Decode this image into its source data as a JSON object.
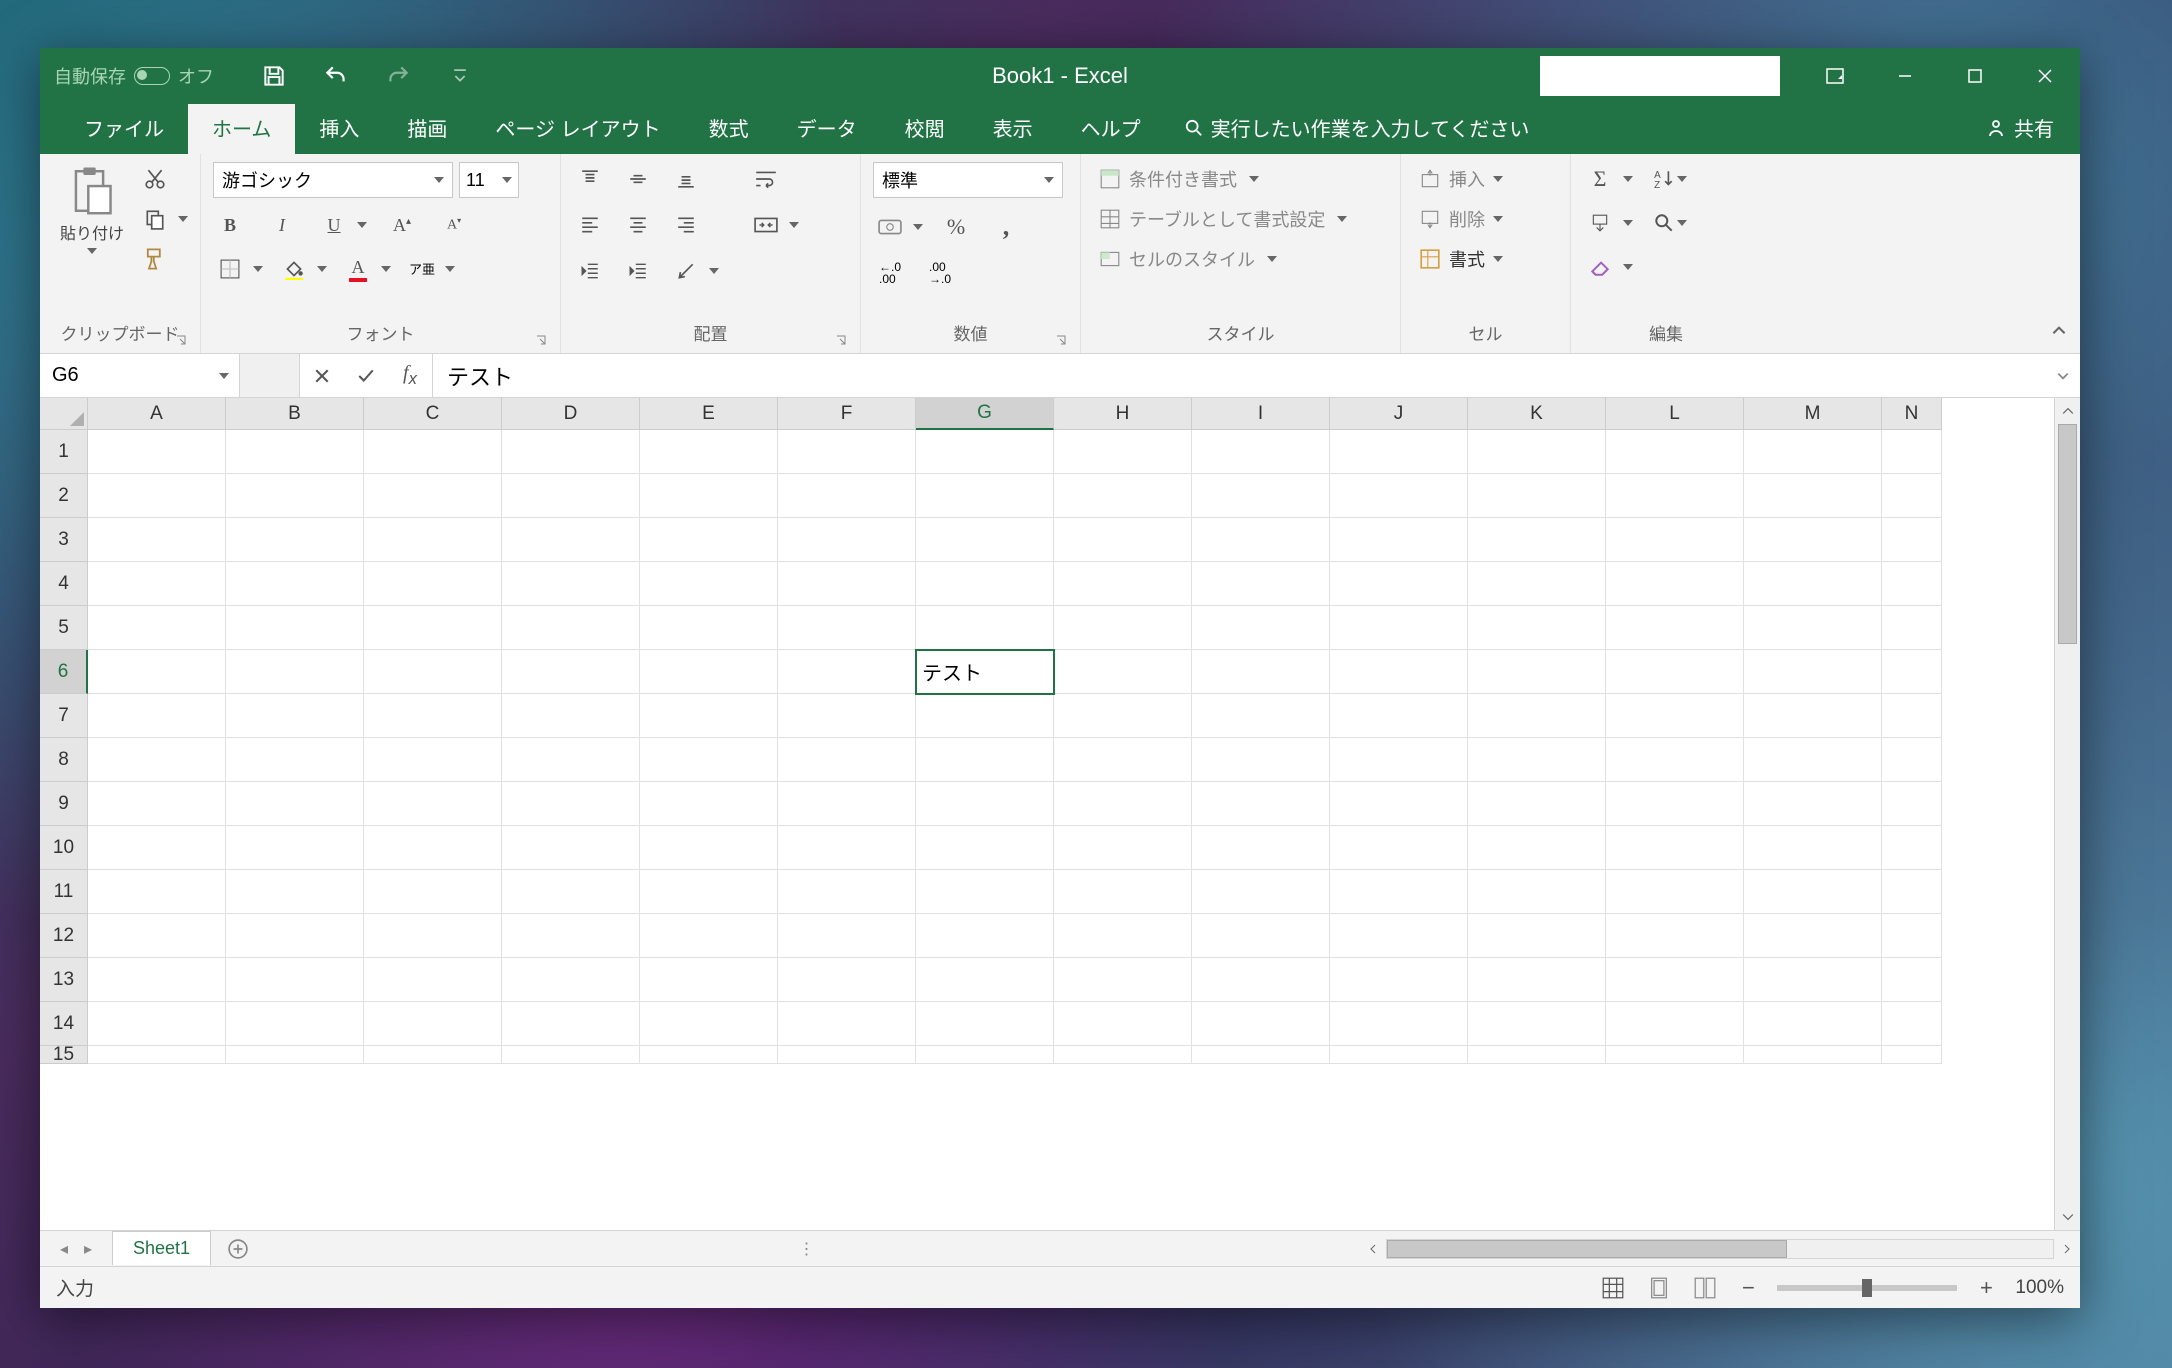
{
  "title_bar": {
    "autosave_label": "自動保存",
    "autosave_state": "オフ",
    "document_title": "Book1  -  Excel"
  },
  "tabs": {
    "file": "ファイル",
    "home": "ホーム",
    "insert": "挿入",
    "draw": "描画",
    "page_layout": "ページ レイアウト",
    "formulas": "数式",
    "data": "データ",
    "review": "校閲",
    "view": "表示",
    "help": "ヘルプ",
    "tell_me": "実行したい作業を入力してください",
    "share": "共有"
  },
  "ribbon": {
    "clipboard": {
      "paste": "貼り付け",
      "label": "クリップボード"
    },
    "font": {
      "name": "游ゴシック",
      "size": "11",
      "label": "フォント",
      "phonetic": "ア亜"
    },
    "alignment": {
      "label": "配置"
    },
    "number": {
      "format": "標準",
      "label": "数値"
    },
    "styles": {
      "conditional": "条件付き書式",
      "table": "テーブルとして書式設定",
      "cell_styles": "セルのスタイル",
      "label": "スタイル"
    },
    "cells": {
      "insert": "挿入",
      "delete": "削除",
      "format": "書式",
      "label": "セル"
    },
    "editing": {
      "label": "編集"
    }
  },
  "formula_bar": {
    "name_box": "G6",
    "formula": "テスト"
  },
  "grid": {
    "columns": [
      "A",
      "B",
      "C",
      "D",
      "E",
      "F",
      "G",
      "H",
      "I",
      "J",
      "K",
      "L",
      "M",
      "N"
    ],
    "rows": [
      "1",
      "2",
      "3",
      "4",
      "5",
      "6",
      "7",
      "8",
      "9",
      "10",
      "11",
      "12",
      "13",
      "14",
      "15"
    ],
    "active_col": "G",
    "active_row": "6",
    "cells": {
      "G6": "テスト"
    }
  },
  "sheet_bar": {
    "sheet1": "Sheet1"
  },
  "status_bar": {
    "mode": "入力",
    "zoom": "100%"
  }
}
